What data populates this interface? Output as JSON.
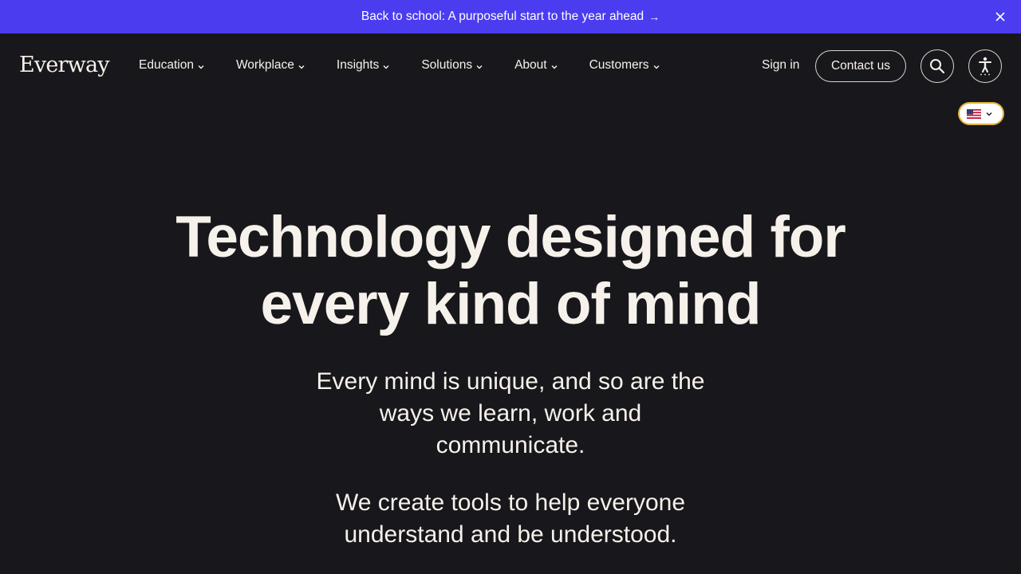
{
  "banner": {
    "text": "Back to school: A purposeful start to the year ahead",
    "arrow": "→",
    "close_icon": "close-icon"
  },
  "nav": {
    "logo": "Everway",
    "items": [
      {
        "label": "Education"
      },
      {
        "label": "Workplace"
      },
      {
        "label": "Insights"
      },
      {
        "label": "Solutions"
      },
      {
        "label": "About"
      },
      {
        "label": "Customers"
      }
    ],
    "sign_in": "Sign in",
    "contact": "Contact us",
    "search_icon": "search-icon",
    "accessibility_icon": "accessibility-icon"
  },
  "language": {
    "selected_flag": "us-flag-icon"
  },
  "hero": {
    "title_line1": "Technology designed for",
    "title_line2": "every kind of mind",
    "subtitle": "Every mind is unique, and so are the ways we learn, work and communicate.",
    "subtitle2": "We create tools to help everyone understand and be understood."
  },
  "colors": {
    "banner": "#4b3cf0",
    "background": "#18171b",
    "text": "#f6f1ea"
  }
}
